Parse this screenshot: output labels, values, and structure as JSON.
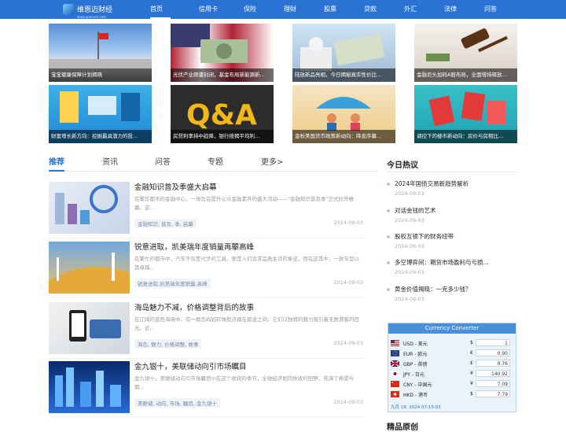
{
  "header": {
    "logo_name": "维恩迈财经",
    "logo_domain": "www.openum.com",
    "nav": [
      {
        "label": "首页",
        "active": true
      },
      {
        "label": "信用卡"
      },
      {
        "label": "保险"
      },
      {
        "label": "理财"
      },
      {
        "label": "股票"
      },
      {
        "label": "贷款"
      },
      {
        "label": "外汇"
      },
      {
        "label": "法律"
      },
      {
        "label": "问答"
      }
    ]
  },
  "featured": [
    {
      "caption": "宝宝健康保障计划揭晓"
    },
    {
      "caption": "光伏产业频遭封闭，基金布局新能源新…"
    },
    {
      "caption": "陆放新品亮相，今日揭秘真实性价比…"
    },
    {
      "caption": "金融巨头加码A股布局，全面增持释放…"
    },
    {
      "caption": "财富增长新方向：挖掘最具潜力的投…"
    },
    {
      "caption": "房贷利率持中趋降，银行按揭平均利…"
    },
    {
      "caption": "金秋美国货币政策新动向：降息序幕…"
    },
    {
      "caption": "调控下的楼市新动向：房价与房租比…"
    }
  ],
  "tabs": [
    "推荐",
    "资讯",
    "问答",
    "专题",
    "更多>"
  ],
  "articles": [
    {
      "title": "金融知识普及季盛大启幕",
      "summary": "在繁华都市的金融中心，一场旨在提升公众金融素养的盛大活动——\"金融知识普及季\"正式拉开帷幕。这...",
      "tags": "金融知识, 普及, 季, 启幕",
      "date": "2024-09-03"
    },
    {
      "title": "锐意进取，凯美瑞年度销量再攀高峰",
      "summary": "在繁忙的都市中，汽车不仅是代步的工具，更是人们追求品质生活的象征。而在这其中，一款车型以其卓越...",
      "tags": "锐意进取,凯美瑞年度销量,高峰",
      "date": "2024-09-03"
    },
    {
      "title": "海岛魅力不减，价格调整背后的故事",
      "summary": "在辽阔的蓝色海境中，有一群岛屿如珍珠般点缀在碧波之间，它们以独特的魅力吸引着无数游客的目光。近...",
      "tags": "海岛, 魅力, 价格调整, 故事",
      "date": "2024-09-03"
    },
    {
      "title": "金九银十，美联储动向引市场瞩目",
      "summary": "金九银十，美联储动向引市场瞩目\\n在这个收获的季节，全球经济如同秋收的田野，充满了希望与期...",
      "tags": "美联储, 动向, 市场, 瞩目, 金九银十",
      "date": "2024-09-03"
    }
  ],
  "sidebar": {
    "hot_title": "今日热议",
    "hot": [
      {
        "title": "2024年国债交易新趋势解析",
        "date": "2024-09-03"
      },
      {
        "title": "对话金钱的艺术",
        "date": "2024-09-03"
      },
      {
        "title": "股权互锁下的财务纽带",
        "date": "2024-09-03"
      },
      {
        "title": "多空博弈间：期货市场盈利与亏损...",
        "date": "2024-09-03"
      },
      {
        "title": "黄金价值揭晓：一克多少钱？",
        "date": "2024-09-03"
      }
    ],
    "converter": {
      "title": "Currency Converter",
      "rows": [
        {
          "code": "USD - 美元",
          "symbol": "$",
          "value": "1"
        },
        {
          "code": "EUR - 欧元",
          "symbol": "€",
          "value": "0.90"
        },
        {
          "code": "GBP - 英镑",
          "symbol": "£",
          "value": "0.76"
        },
        {
          "code": "JPY - 日元",
          "symbol": "¥",
          "value": "140.92"
        },
        {
          "code": "CNY - 中国元",
          "symbol": "¥",
          "value": "7.09"
        },
        {
          "code": "HKD - 港币",
          "symbol": "$",
          "value": "7.79"
        }
      ],
      "footer": "九月 18, 2024 07:15:03"
    },
    "next_title": "精品原创"
  }
}
